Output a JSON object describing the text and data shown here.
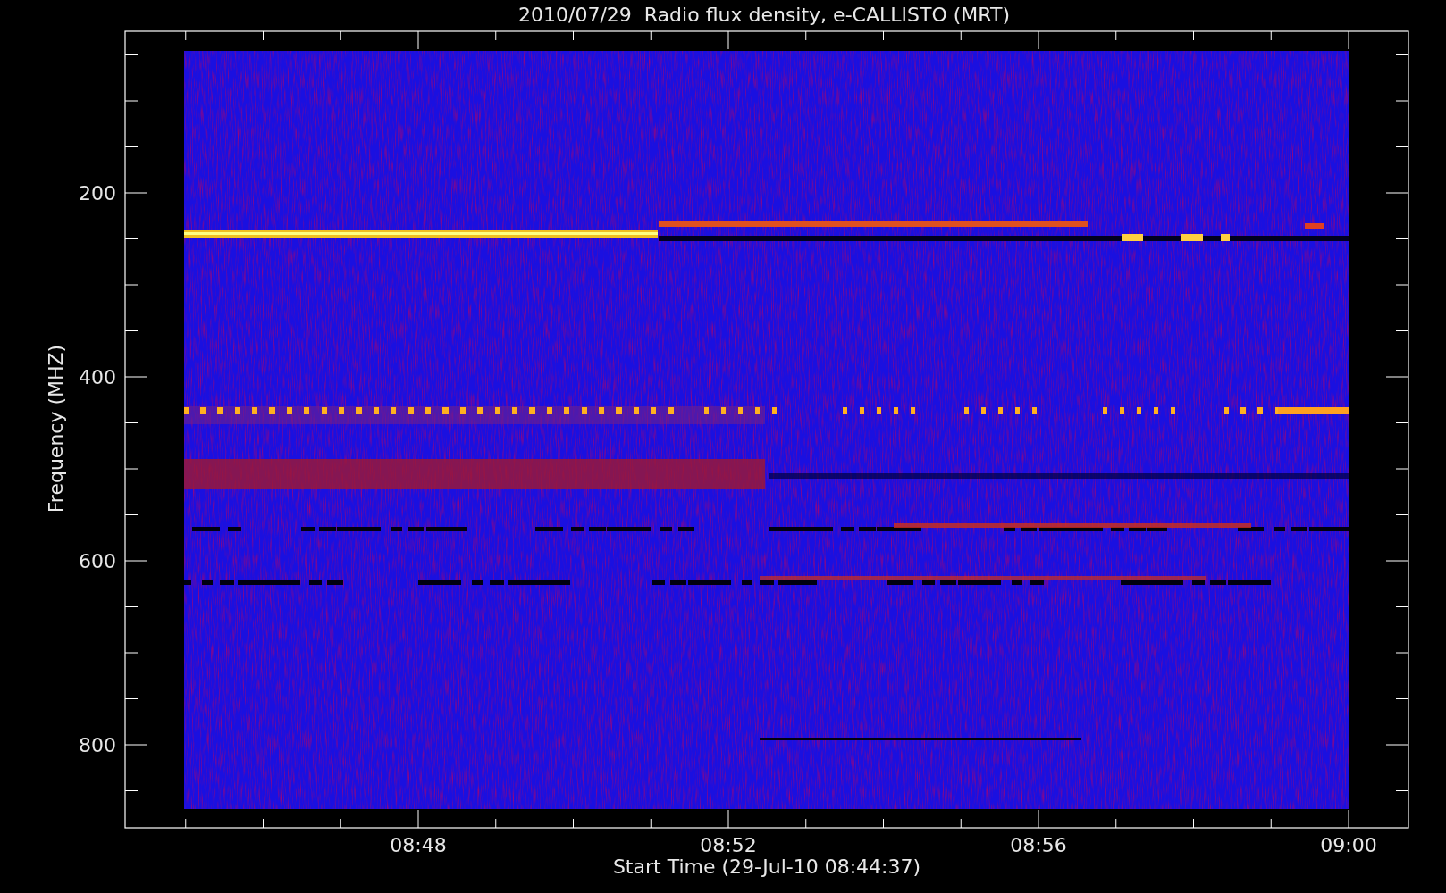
{
  "title": "2010/07/29  Radio flux density, e-CALLISTO (MRT)",
  "y_axis": {
    "label": "Frequency (MHZ)",
    "ticks": [
      "200",
      "400",
      "600",
      "800"
    ]
  },
  "x_axis": {
    "label": "Start Time (29-Jul-10 08:44:37)",
    "ticks": [
      "08:48",
      "08:52",
      "08:56",
      "09:00"
    ]
  }
}
